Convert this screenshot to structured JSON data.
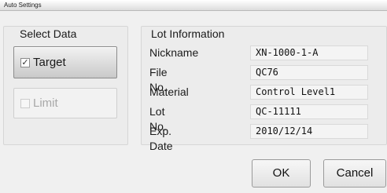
{
  "window": {
    "title": "Auto Settings"
  },
  "select_data": {
    "heading": "Select Data",
    "target": {
      "label": "Target",
      "checked": true,
      "checkmark": "✓"
    },
    "limit": {
      "label": "Limit",
      "checked": false,
      "enabled": false
    }
  },
  "lot_information": {
    "heading": "Lot Information",
    "rows": [
      {
        "label": "Nickname",
        "value": "XN-1000-1-A"
      },
      {
        "label": "File No.",
        "value": "QC76"
      },
      {
        "label": "Material",
        "value": "Control Level1"
      },
      {
        "label": "Lot No.",
        "value": "QC-11111"
      },
      {
        "label": "Exp. Date",
        "value": "2010/12/14"
      }
    ]
  },
  "buttons": {
    "ok": "OK",
    "cancel": "Cancel"
  }
}
